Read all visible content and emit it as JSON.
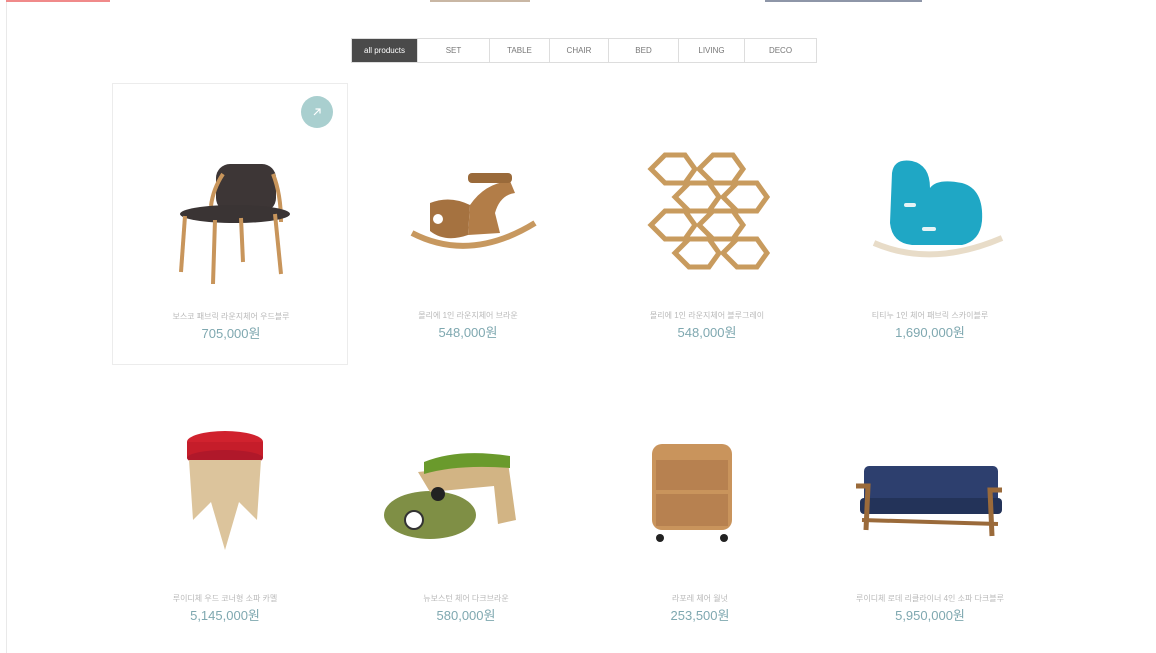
{
  "tabs": [
    "all products",
    "SET",
    "TABLE",
    "CHAIR",
    "BED",
    "LIVING",
    "DECO"
  ],
  "active_tab": "all products",
  "colors": {
    "active_tab_bg": "#4a4a4a",
    "price": "#7fa8b0",
    "name": "#b9b9b9",
    "arrow_button": "#a9cfcf"
  },
  "products": [
    {
      "name": "보스코 패브릭 라운지체어 우드블루",
      "price": "705,000원",
      "icon": "armchair-icon"
    },
    {
      "name": "몰리에 1인 라운지체어 브라운",
      "price": "548,000원",
      "icon": "rocking-horse-icon"
    },
    {
      "name": "몰리에 1인 라운지체어 블루그레이",
      "price": "548,000원",
      "icon": "hexagon-shelf-icon"
    },
    {
      "name": "티티누 1인 체어 패브릭 스카이블루",
      "price": "1,690,000원",
      "icon": "rocking-chair-icon"
    },
    {
      "name": "루이디체 우드 코너형 소파 카멜",
      "price": "5,145,000원",
      "icon": "stool-icon"
    },
    {
      "name": "뉴보스턴 체어 다크브라운",
      "price": "580,000원",
      "icon": "kids-soccer-bench-icon"
    },
    {
      "name": "라포레 체어 월넛",
      "price": "253,500원",
      "icon": "drawer-cabinet-icon"
    },
    {
      "name": "루이디체 로데 리클라이너 4인 소파 다크블루",
      "price": "5,950,000원",
      "icon": "sofa-icon"
    }
  ]
}
